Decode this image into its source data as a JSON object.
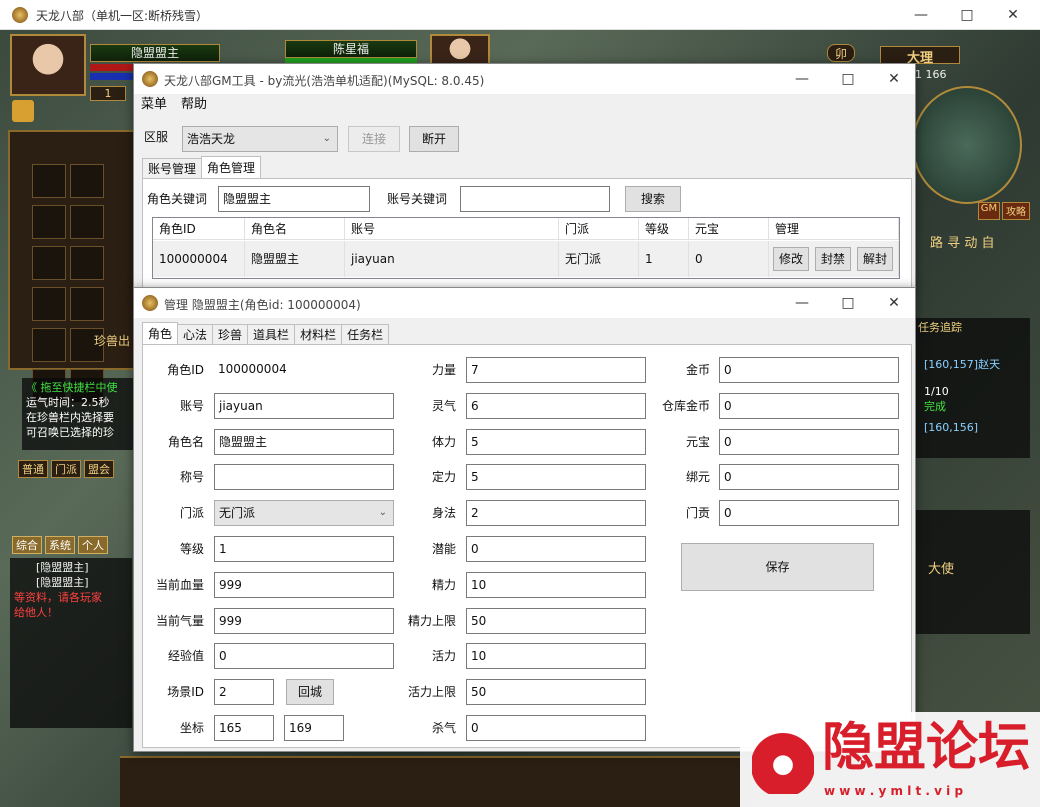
{
  "game": {
    "title": "天龙八部（单机一区:断桥残雪）",
    "player_name": "隐盟盟主",
    "level": "1",
    "target_name": "陈星福",
    "map_name": "大理",
    "coords": "1 166",
    "tab_chars": "卯",
    "chat_tabs": [
      "综合",
      "系统",
      "个人"
    ],
    "channel_tabs": [
      "普通",
      "门派",
      "盟会"
    ],
    "pet_label": "珍兽出",
    "tip_lines": [
      "《 拖至快捷栏中使",
      "运气时间：2.5秒",
      "在珍兽栏内选择要",
      "可召唤已选择的珍"
    ],
    "chat_lines": [
      "[隐盟盟主]",
      "[隐盟盟主]",
      "等资料，请各玩家",
      "给他人！"
    ],
    "quest_lines": [
      "[160,157]赵天",
      "1/10",
      "完成",
      "[160,156]"
    ],
    "side_btns": [
      "GM",
      "攻略"
    ],
    "side_text": [
      "路",
      "寻",
      "动",
      "自"
    ],
    "quest_track": "任务追踪",
    "quest_big": "大使"
  },
  "gm": {
    "title": "天龙八部GM工具 - by流光(浩浩单机适配)(MySQL: 8.0.45)",
    "menu": [
      "菜单",
      "帮助"
    ],
    "server_label": "区服",
    "server_value": "浩浩天龙",
    "connect": "连接",
    "disconnect": "断开",
    "tabs": [
      "账号管理",
      "角色管理"
    ],
    "role_kw_label": "角色关键词",
    "role_kw_value": "隐盟盟主",
    "acct_kw_label": "账号关键词",
    "acct_kw_value": "",
    "search": "搜索",
    "columns": [
      "角色ID",
      "角色名",
      "账号",
      "门派",
      "等级",
      "元宝",
      "管理"
    ],
    "row": {
      "id": "100000004",
      "name": "隐盟盟主",
      "account": "jiayuan",
      "sect": "无门派",
      "level": "1",
      "yuanbao": "0"
    },
    "row_btns": [
      "修改",
      "封禁",
      "解封"
    ]
  },
  "mgr": {
    "title": "管理 隐盟盟主(角色id: 100000004)",
    "tabs": [
      "角色",
      "心法",
      "珍兽",
      "道具栏",
      "材料栏",
      "任务栏"
    ],
    "col1": [
      {
        "l": "角色ID",
        "v": "100000004"
      },
      {
        "l": "账号",
        "v": "jiayuan"
      },
      {
        "l": "角色名",
        "v": "隐盟盟主"
      },
      {
        "l": "称号",
        "v": ""
      },
      {
        "l": "门派",
        "v": "无门派"
      },
      {
        "l": "等级",
        "v": "1"
      },
      {
        "l": "当前血量",
        "v": "999"
      },
      {
        "l": "当前气量",
        "v": "999"
      },
      {
        "l": "经验值",
        "v": "0"
      }
    ],
    "scene_label": "场景ID",
    "scene_value": "2",
    "return_city": "回城",
    "coord_label": "坐标",
    "coord_x": "165",
    "coord_y": "169",
    "col2": [
      {
        "l": "力量",
        "v": "7"
      },
      {
        "l": "灵气",
        "v": "6"
      },
      {
        "l": "体力",
        "v": "5"
      },
      {
        "l": "定力",
        "v": "5"
      },
      {
        "l": "身法",
        "v": "2"
      },
      {
        "l": "潜能",
        "v": "0"
      },
      {
        "l": "精力",
        "v": "10"
      },
      {
        "l": "精力上限",
        "v": "50"
      },
      {
        "l": "活力",
        "v": "10"
      },
      {
        "l": "活力上限",
        "v": "50"
      },
      {
        "l": "杀气",
        "v": "0"
      }
    ],
    "col3": [
      {
        "l": "金币",
        "v": "0"
      },
      {
        "l": "仓库金币",
        "v": "0"
      },
      {
        "l": "元宝",
        "v": "0"
      },
      {
        "l": "绑元",
        "v": "0"
      },
      {
        "l": "门贡",
        "v": "0"
      }
    ],
    "save": "保存"
  },
  "watermark": {
    "text": "隐盟论坛",
    "url": "w w w . y m l t . v i p"
  }
}
